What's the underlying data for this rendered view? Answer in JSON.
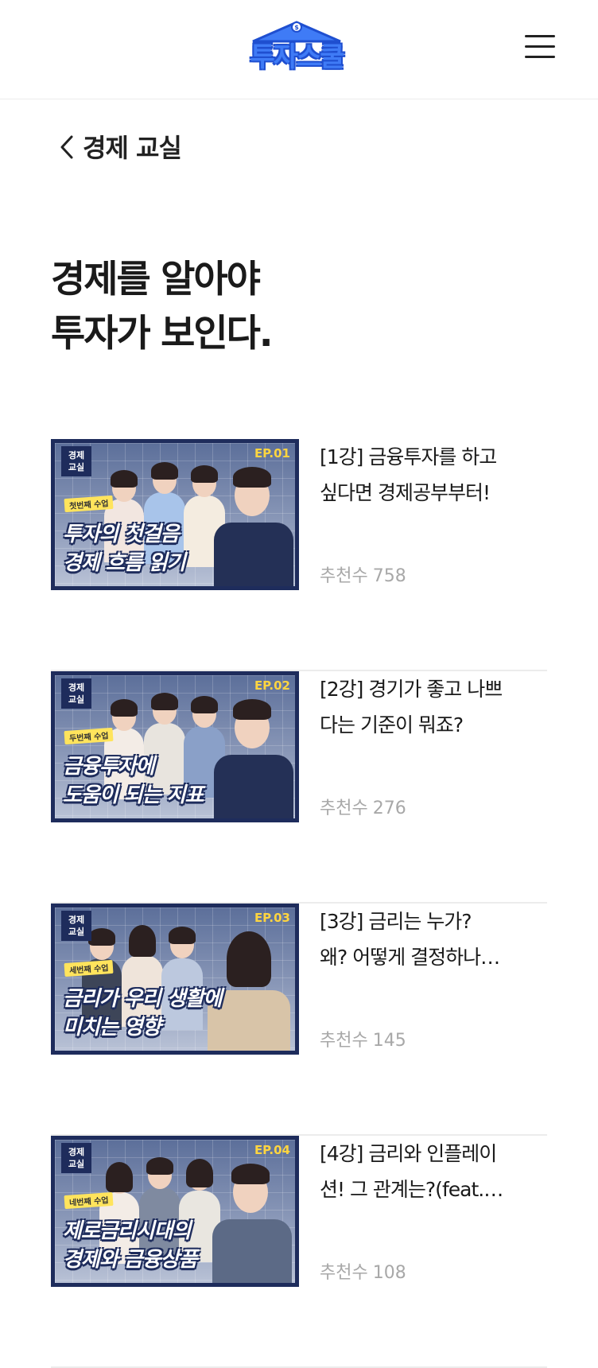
{
  "header": {
    "logo_text": "투자스쿨",
    "menu_icon": "hamburger-menu-icon"
  },
  "nav": {
    "back_label": "경제 교실",
    "back_icon": "chevron-left-icon"
  },
  "hero": {
    "line1": "경제를 알아야",
    "line2": "투자가 보인다."
  },
  "colors": {
    "brand_blue": "#3f7bf6",
    "thumb_navy": "#1e2c5c",
    "ep_yellow": "#ffd540",
    "meta_gray": "#a8a8a8"
  },
  "items": [
    {
      "thumb_badge": "경제\n교실",
      "thumb_ep": "EP.01",
      "thumb_tag": "첫번째 수업",
      "thumb_line1": "투자의 첫걸음",
      "thumb_line2": "경제 흐름 읽기",
      "title_line1": "[1강] 금융투자를 하고",
      "title_line2": "싶다면 경제공부부터!",
      "likes_label": "추천수",
      "likes_count": "758"
    },
    {
      "thumb_badge": "경제\n교실",
      "thumb_ep": "EP.02",
      "thumb_tag": "두번째 수업",
      "thumb_line1": "금융투자에",
      "thumb_line2": "도움이 되는 지표",
      "title_line1": "[2강] 경기가 좋고 나쁘",
      "title_line2": "다는 기준이 뭐죠?",
      "likes_label": "추천수",
      "likes_count": "276"
    },
    {
      "thumb_badge": "경제\n교실",
      "thumb_ep": "EP.03",
      "thumb_tag": "세번째 수업",
      "thumb_line1": "금리가 우리 생활에",
      "thumb_line2": "미치는 영향",
      "title_line1": "[3강] 금리는 누가?",
      "title_line2": "왜? 어떻게 결정하나…",
      "likes_label": "추천수",
      "likes_count": "145"
    },
    {
      "thumb_badge": "경제\n교실",
      "thumb_ep": "EP.04",
      "thumb_tag": "네번째 수업",
      "thumb_line1": "제로금리시대의",
      "thumb_line2": "경제와 금융상품",
      "title_line1": "[4강] 금리와 인플레이",
      "title_line2": "션! 그 관계는?(feat.…",
      "likes_label": "추천수",
      "likes_count": "108"
    }
  ]
}
